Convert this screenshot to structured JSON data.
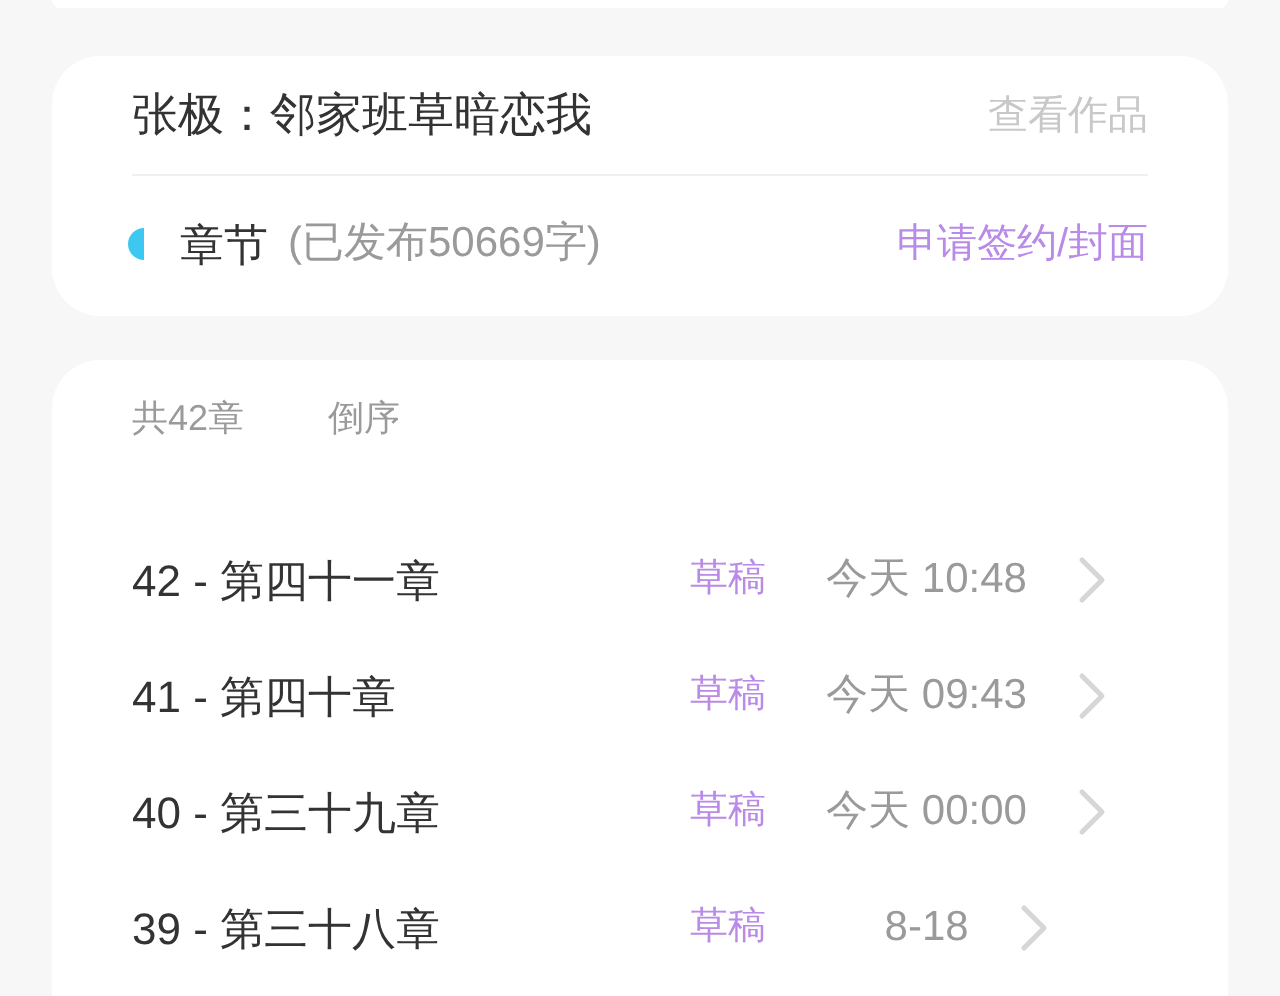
{
  "work_card": {
    "title": "张极：邻家班草暗恋我",
    "view_link": "查看作品",
    "section_label": "章节",
    "section_info": "(已发布50669字)",
    "action_link": "申请签约/封面"
  },
  "chapter_list": {
    "count": "共42章",
    "sort": "倒序",
    "rows": [
      {
        "title": "42 - 第四十一章",
        "status": "草稿",
        "time": "今天 10:48"
      },
      {
        "title": "41 - 第四十章",
        "status": "草稿",
        "time": "今天 09:43"
      },
      {
        "title": "40 - 第三十九章",
        "status": "草稿",
        "time": "今天 00:00"
      },
      {
        "title": "39 - 第三十八章",
        "status": "草稿",
        "time": "8-18"
      }
    ]
  }
}
